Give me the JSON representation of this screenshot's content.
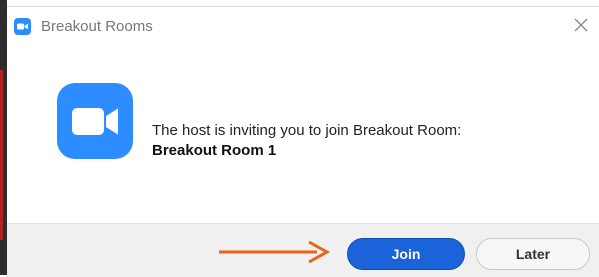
{
  "window": {
    "title": "Breakout Rooms",
    "title_icon": "zoom-camera-icon",
    "close_icon": "close-icon"
  },
  "content": {
    "app_icon": "zoom-video-camera-icon",
    "message_line1": "The host is inviting you to join Breakout Room:",
    "room_name": "Breakout Room 1"
  },
  "actions": {
    "join_label": "Join",
    "later_label": "Later",
    "pointer": "arrow-right-icon"
  },
  "colors": {
    "zoom_blue": "#2d8cff",
    "join_button": "#1b63d8",
    "arrow": "#e8641b"
  }
}
